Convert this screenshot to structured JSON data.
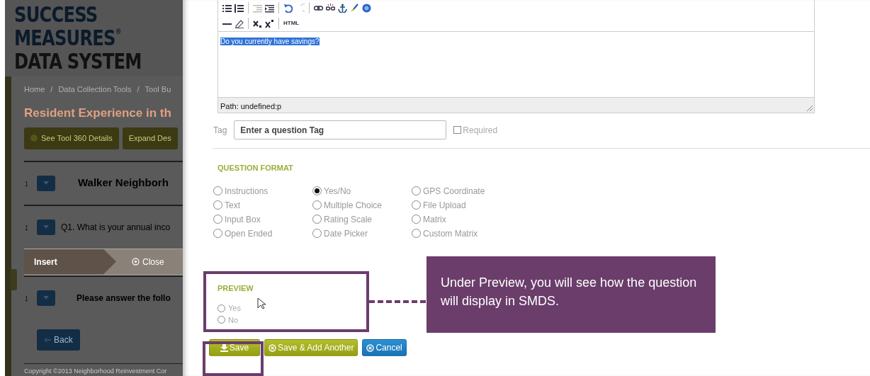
{
  "background_page": {
    "logo": [
      "SUCCESS",
      "MEASURES$^{®}$",
      "DATA SYSTEM"
    ],
    "breadcrumb": [
      "Home",
      "Data Collection Tools",
      "Tool Bu"
    ],
    "breadcrumb_separator": "/",
    "title": "Resident Experience in th",
    "buttons": [
      {
        "kind": "info",
        "label": "See Tool 360 Details"
      },
      {
        "kind": "plain",
        "label": "Expand Des"
      }
    ],
    "rows": [
      {
        "kind": "section",
        "handle": "↕",
        "text": "Walker Neighborh"
      },
      {
        "kind": "question",
        "handle": "↕",
        "text": "Q1. What is your annual inco"
      },
      {
        "kind": "insert",
        "text": "Insert",
        "close": "Close"
      },
      {
        "kind": "instruction",
        "handle": "↕",
        "text": "Please answer the follo"
      }
    ],
    "back_button": "Back",
    "footer": "Copyright ©2013 Neighborhood Reinvestment Cor"
  },
  "editor": {
    "html_button": "HTML",
    "content": "Do you currently have savings?",
    "path": "Path: undefined:p"
  },
  "tag": {
    "label": "Tag",
    "placeholder": "Enter a question Tag"
  },
  "required": {
    "label": "Required",
    "checked": false
  },
  "question_format": {
    "title": "QUESTION FORMAT",
    "options": [
      {
        "label": "Instructions",
        "selected": false
      },
      {
        "label": "Text",
        "selected": false
      },
      {
        "label": "Input Box",
        "selected": false
      },
      {
        "label": "Open Ended",
        "selected": false
      },
      {
        "label": "Yes/No",
        "selected": true
      },
      {
        "label": "Multiple Choice",
        "selected": false
      },
      {
        "label": "Rating Scale",
        "selected": false
      },
      {
        "label": "Date Picker",
        "selected": false
      },
      {
        "label": "GPS Coordinate",
        "selected": false
      },
      {
        "label": "File Upload",
        "selected": false
      },
      {
        "label": "Matrix",
        "selected": false
      },
      {
        "label": "Custom Matrix",
        "selected": false
      }
    ]
  },
  "preview": {
    "title": "PREVIEW",
    "options": [
      {
        "label": "Yes",
        "selected": false
      },
      {
        "label": "No",
        "selected": false
      }
    ]
  },
  "buttons": [
    {
      "kind": "save",
      "label": "Save"
    },
    {
      "kind": "save_add",
      "label": "Save & Add Another"
    },
    {
      "kind": "cancel",
      "label": "Cancel"
    }
  ],
  "callout": {
    "text": "Under Preview, you will see how the question will display in SMDS."
  }
}
